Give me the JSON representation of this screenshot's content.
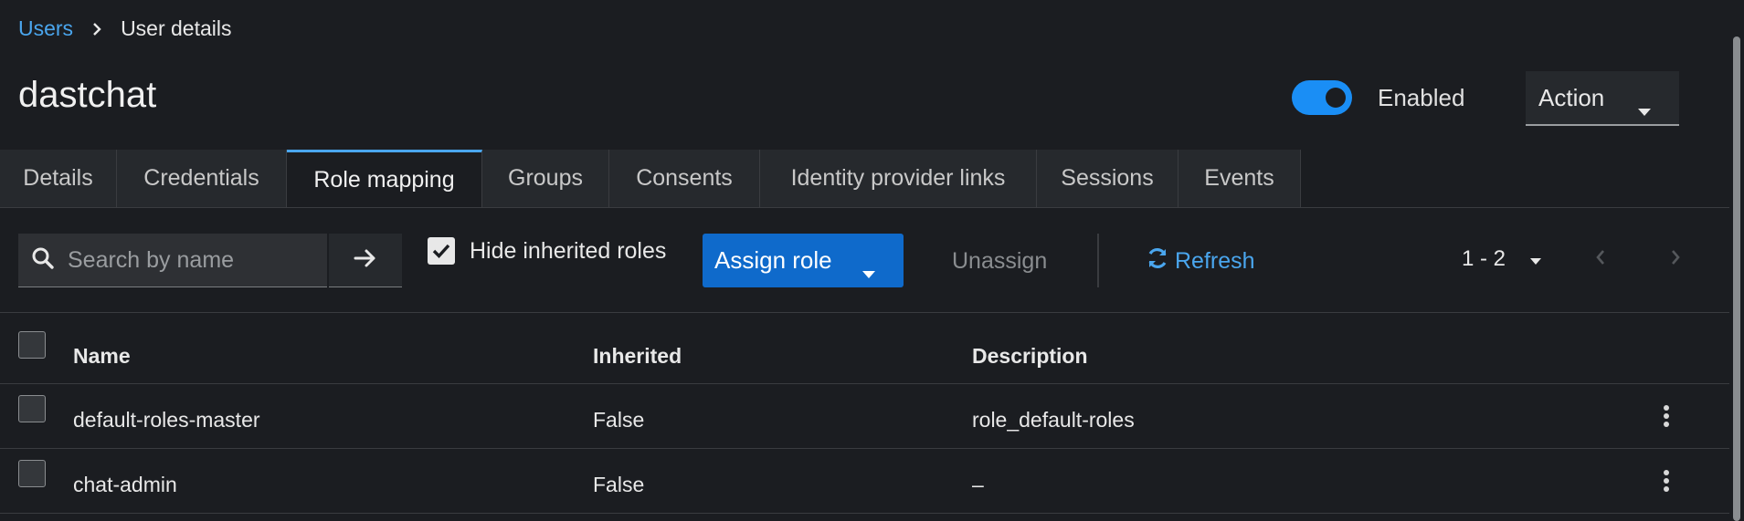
{
  "breadcrumb": {
    "parent": "Users",
    "current": "User details"
  },
  "page": {
    "title": "dastchat"
  },
  "header": {
    "enabled_label": "Enabled",
    "enabled": true,
    "action_label": "Action"
  },
  "tabs": [
    {
      "label": "Details"
    },
    {
      "label": "Credentials"
    },
    {
      "label": "Role mapping",
      "active": true
    },
    {
      "label": "Groups"
    },
    {
      "label": "Consents"
    },
    {
      "label": "Identity provider links"
    },
    {
      "label": "Sessions"
    },
    {
      "label": "Events"
    }
  ],
  "toolbar": {
    "search_placeholder": "Search by name",
    "search_value": "",
    "hide_inherited_label": "Hide inherited roles",
    "hide_inherited_checked": true,
    "assign_label": "Assign role",
    "unassign_label": "Unassign",
    "refresh_label": "Refresh",
    "pagination": "1 - 2"
  },
  "table": {
    "columns": [
      "Name",
      "Inherited",
      "Description"
    ],
    "rows": [
      {
        "name": "default-roles-master",
        "inherited": "False",
        "description": "role_default-roles"
      },
      {
        "name": "chat-admin",
        "inherited": "False",
        "description": "–"
      }
    ]
  },
  "icons": {
    "breadcrumb_sep": "chevron-right-icon",
    "search": "search-icon",
    "go": "arrow-right-icon",
    "refresh": "sync-icon",
    "kebab": "kebab-menu-icon"
  },
  "colors": {
    "accent": "#4aa6ee",
    "primary_button": "#0f6acb",
    "switch_on": "#1a8ef5",
    "background": "#1b1d21"
  }
}
